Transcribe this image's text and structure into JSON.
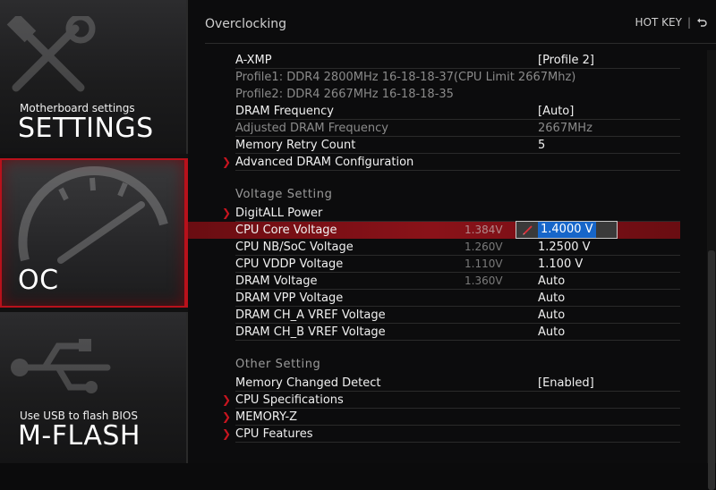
{
  "sidebar": {
    "settings": {
      "subtitle": "Motherboard settings",
      "title": "SETTINGS"
    },
    "oc": {
      "title": "OC"
    },
    "mflash": {
      "subtitle": "Use USB to flash BIOS",
      "title": "M-FLASH"
    }
  },
  "header": {
    "title": "Overclocking",
    "hotkey_label": "HOT KEY",
    "separator": "|"
  },
  "rows": [
    {
      "label": "A-XMP",
      "value": "[Profile 2]"
    },
    {
      "label": "Profile1: DDR4 2800MHz 16-18-18-37(CPU Limit 2667Mhz)"
    },
    {
      "label": "Profile2: DDR4 2667MHz 16-18-18-35"
    },
    {
      "label": "DRAM Frequency",
      "value": "[Auto]"
    },
    {
      "label": "Adjusted DRAM Frequency",
      "value": "2667MHz"
    },
    {
      "label": "Memory Retry Count",
      "value": "5"
    },
    {
      "label": "Advanced DRAM Configuration"
    },
    {
      "label": "Voltage  Setting"
    },
    {
      "label": "DigitALL Power"
    },
    {
      "label": "CPU Core Voltage",
      "current": "1.384V",
      "value": "1.4000 V"
    },
    {
      "label": "CPU NB/SoC Voltage",
      "current": "1.260V",
      "value": "1.2500 V"
    },
    {
      "label": "CPU VDDP Voltage",
      "current": "1.110V",
      "value": "1.100 V"
    },
    {
      "label": "DRAM Voltage",
      "current": "1.360V",
      "value": "Auto"
    },
    {
      "label": "DRAM VPP Voltage",
      "value": "Auto"
    },
    {
      "label": "DRAM CH_A VREF Voltage",
      "value": "Auto"
    },
    {
      "label": "DRAM CH_B VREF Voltage",
      "value": "Auto"
    },
    {
      "label": "Other  Setting"
    },
    {
      "label": "Memory Changed Detect",
      "value": "[Enabled]"
    },
    {
      "label": "CPU Specifications"
    },
    {
      "label": "MEMORY-Z"
    },
    {
      "label": "CPU Features"
    }
  ],
  "icons": {
    "submenu_arrow": "chevron-right-icon",
    "edit": "pencil-icon",
    "back": "back-arrow-icon"
  },
  "colors": {
    "accent": "#c8151f",
    "selection": "#8a1219",
    "edit_highlight": "#1766c9"
  }
}
